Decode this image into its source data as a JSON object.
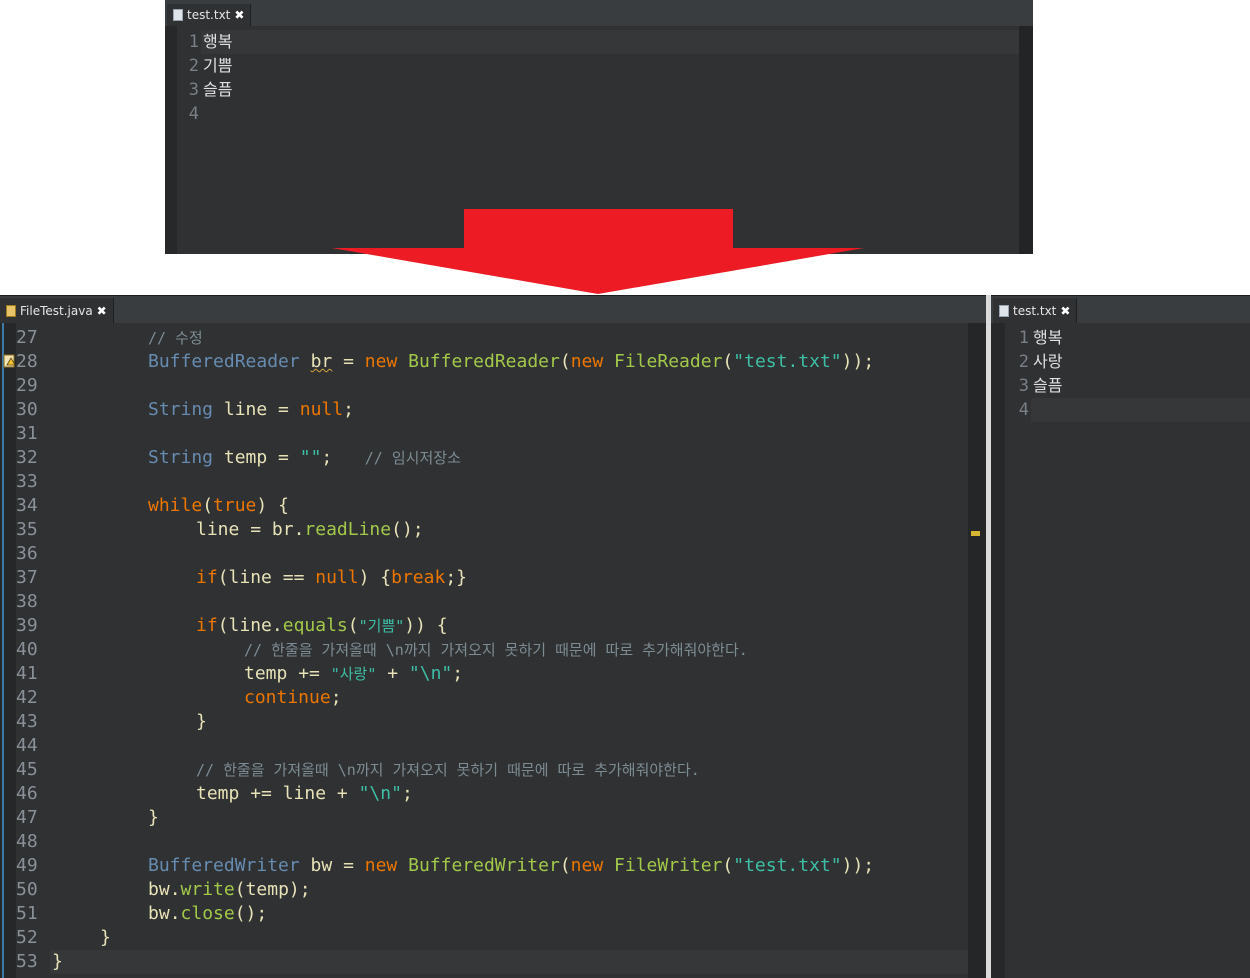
{
  "top_editor": {
    "tab_label": "test.txt",
    "close_glyph": "✖",
    "line_numbers": [
      "1",
      "2",
      "3",
      "4"
    ],
    "lines": [
      "행복",
      "기쁨",
      "슬픔",
      ""
    ]
  },
  "java_editor": {
    "tab_label": "FileTest.java",
    "close_glyph": "✖",
    "line_numbers": [
      "27",
      "28",
      "29",
      "30",
      "31",
      "32",
      "33",
      "34",
      "35",
      "36",
      "37",
      "38",
      "39",
      "40",
      "41",
      "42",
      "43",
      "44",
      "45",
      "46",
      "47",
      "48",
      "49",
      "50",
      "51",
      "52",
      "53"
    ],
    "code": {
      "l27_comment": "// 수정",
      "l28": {
        "type": "BufferedReader",
        "var": "br",
        "eq": " = ",
        "new1": "new",
        "cls1": " BufferedReader",
        "p1": "(",
        "new2": "new",
        "cls2": " FileReader",
        "p2": "(",
        "str": "\"test.txt\"",
        "end": "));"
      },
      "l30": {
        "type": "String",
        "var": " line",
        "eq": " = ",
        "kw": "null",
        "end": ";"
      },
      "l32": {
        "type": "String",
        "var": " temp",
        "eq": " = ",
        "str": "\"\"",
        "end": ";",
        "comment": "// 임시저장소"
      },
      "l34": {
        "kw": "while",
        "p": "(",
        "kw2": "true",
        "end": ") {"
      },
      "l35": {
        "var": "line",
        "eq": " = ",
        "obj": "br",
        "dot": ".",
        "method": "readLine",
        "end": "();"
      },
      "l37": {
        "kw": "if",
        "p": "(",
        "var": "line",
        "op": " == ",
        "kw2": "null",
        "mid": ") {",
        "kw3": "break",
        "end": ";}"
      },
      "l39": {
        "kw": "if",
        "p": "(",
        "var": "line",
        "dot": ".",
        "method": "equals",
        "p2": "(",
        "str": "\"기쁨\"",
        "end": ")) {"
      },
      "l40_comment": "// 한줄을 가져올때 \\n까지 가져오지 못하기 때문에 따로 추가해줘야한다.",
      "l41": {
        "var": "temp",
        "op": " += ",
        "str1": "\"사랑\"",
        "plus": " + ",
        "str2": "\"\\n\"",
        "end": ";"
      },
      "l42": {
        "kw": "continue",
        "end": ";"
      },
      "l43": "}",
      "l45_comment": "// 한줄을 가져올때 \\n까지 가져오지 못하기 때문에 따로 추가해줘야한다.",
      "l46": {
        "var": "temp",
        "op": " += ",
        "var2": "line",
        "plus": " + ",
        "str": "\"\\n\"",
        "end": ";"
      },
      "l47": "}",
      "l49": {
        "type": "BufferedWriter",
        "var": " bw",
        "eq": " = ",
        "new1": "new",
        "cls1": " BufferedWriter",
        "p1": "(",
        "new2": "new",
        "cls2": " FileWriter",
        "p2": "(",
        "str": "\"test.txt\"",
        "end": "));"
      },
      "l50": {
        "obj": "bw",
        "dot": ".",
        "method": "write",
        "p": "(",
        "var": "temp",
        "end": ");"
      },
      "l51": {
        "obj": "bw",
        "dot": ".",
        "method": "close",
        "end": "();"
      },
      "l52": "}",
      "l53": "}"
    }
  },
  "right_editor": {
    "tab_label": "test.txt",
    "close_glyph": "✖",
    "line_numbers": [
      "1",
      "2",
      "3",
      "4"
    ],
    "lines": [
      "행복",
      "사랑",
      "슬픔",
      ""
    ]
  },
  "colors": {
    "arrow": "#ed1c24",
    "keyword": "#ec7600",
    "type": "#678cb1",
    "string": "#3ebfa5",
    "method": "#a3c94a",
    "comment": "#7d8c93"
  }
}
